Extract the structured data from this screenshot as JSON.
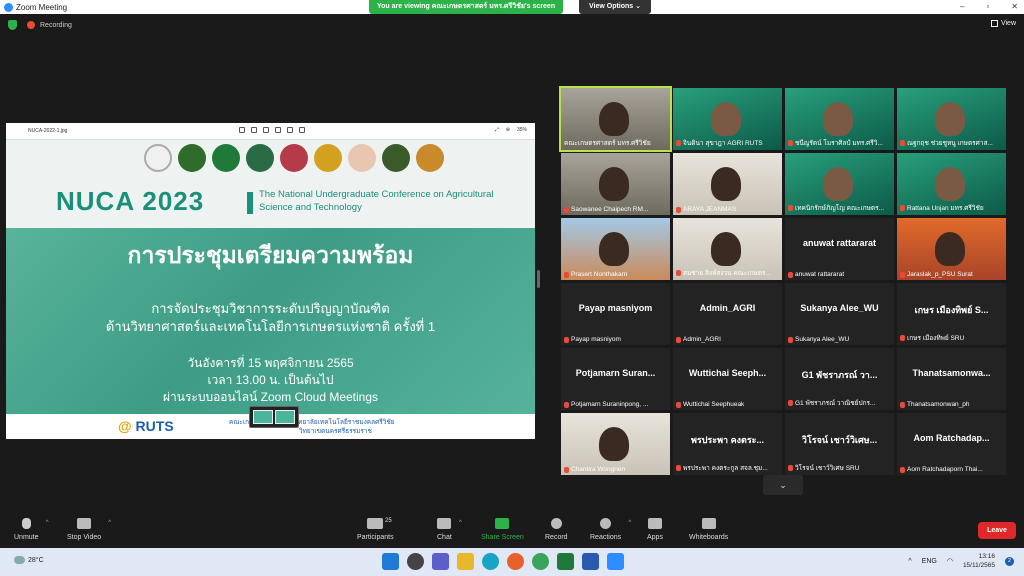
{
  "window": {
    "title": "Zoom Meeting",
    "controls": [
      "–",
      "▫",
      "✕"
    ]
  },
  "banner": {
    "viewing": "You are viewing คณะเกษตรศาสตร์ มทร.ศรีวิชัย's screen",
    "view_options": "View Options ⌄"
  },
  "topbar": {
    "recording": "Recording",
    "view": "View"
  },
  "shared": {
    "filename": "NUCA-2022-1.jpg",
    "zoom": "35%",
    "nuca": "NUCA 2023",
    "conference": "The National Undergraduate Conference on Agricultural Science and Technology",
    "heading": "การประชุมเตรียมความพร้อม",
    "sub1": "การจัดประชุมวิชาการระดับปริญญาบัณฑิต",
    "sub2": "ด้านวิทยาศาสตร์และเทคโนโลยีการเกษตรแห่งชาติ ครั้งที่ 1",
    "date1": "วันอังคารที่ 15 พฤศจิกายน 2565",
    "date2": "เวลา 13.00 น. เป็นต้นไป",
    "date3": "ผ่านระบบออนไลน์ Zoom Cloud Meetings",
    "footer_logo": "RUTS",
    "footer_line1": "คณะเกษตรศาสตร์ มหาวิทยาลัยเทคโนโลยีราชมงคลศรีวิชัย",
    "footer_line2": "วิทยาเขตนครศรีธรรมราช"
  },
  "participants": [
    {
      "name": "คณะเกษตรศาสตร์ มทร.ศรีวิชัย",
      "video": "room",
      "active": true
    },
    {
      "name": "จินดินา สุขาฎา AGRI RUTS",
      "video": "agri"
    },
    {
      "name": "ชนีญรัตน์ โมราศิลป์ มทร.ศรีวิ...",
      "video": "agri"
    },
    {
      "name": "ณฐกฤช ช่วยชูหนู เกษตรศาส...",
      "video": "agri"
    },
    {
      "name": "Saowanee Chaipech RM...",
      "video": "room"
    },
    {
      "name": "ARAYA JEANMAS",
      "video": "white"
    },
    {
      "name": "เทคนิกรักษ์ภิญโญ คณะเกษตร...",
      "video": "agri"
    },
    {
      "name": "Rattana Unjan มทร.ศรีวิชัย",
      "video": "agri"
    },
    {
      "name": "Prasert Nonthakarn",
      "video": "sky"
    },
    {
      "name": "สมชาย สิงห์สงวน คณะเกษตร...",
      "video": "white"
    },
    {
      "name": "anuwat rattararat",
      "big": "anuwat rattararat"
    },
    {
      "name": "Jaraslak_p_PSU Surat",
      "video": "orange"
    },
    {
      "name": "Payap masniyom",
      "big": "Payap masniyom"
    },
    {
      "name": "Admin_AGRI",
      "big": "Admin_AGRI"
    },
    {
      "name": "Sukanya Alee_WU",
      "big": "Sukanya Alee_WU"
    },
    {
      "name": "เกษร เมืองทิพย์ SRU",
      "big": "เกษร เมืองทิพย์ S..."
    },
    {
      "name": "Potjamarn Suraninpong, ...",
      "big": "Potjamarn Suran..."
    },
    {
      "name": "Wuttichai Seephueak",
      "big": "Wuttichai Seeph..."
    },
    {
      "name": "G1 พัชราภรณ์ วาณิชย์ปกร...",
      "big": "G1 พัชราภรณ์ วา..."
    },
    {
      "name": "Thanatsamonwan_ph",
      "big": "Thanatsamonwa..."
    },
    {
      "name": "Chantira Wongnen",
      "video": "white"
    },
    {
      "name": "พรประพา คงตระกูล สจล.ชุม...",
      "big": "พรประพา คงตระ..."
    },
    {
      "name": "วิโรจน์ เชาว์วิเศษ SRU",
      "big": "วิโรจน์ เชาว์วิเศษ..."
    },
    {
      "name": "Aom Ratchadaporn Thai...",
      "big": "Aom Ratchadap..."
    }
  ],
  "controls": {
    "unmute": "Unmute",
    "stop_video": "Stop Video",
    "participants": "Participants",
    "participants_count": "25",
    "chat": "Chat",
    "share": "Share Screen",
    "record": "Record",
    "reactions": "Reactions",
    "apps": "Apps",
    "whiteboards": "Whiteboards",
    "leave": "Leave"
  },
  "taskbar": {
    "temp": "28°C",
    "lang": "ENG",
    "time": "13:16",
    "date": "15/11/2565",
    "notif": "2"
  },
  "colors": {
    "accent_green": "#2db24a",
    "leave_red": "#e02828",
    "slide_teal": "#1a8f7a"
  }
}
